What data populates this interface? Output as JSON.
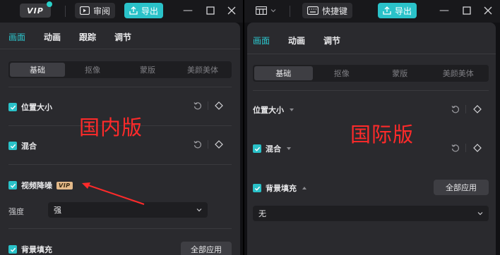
{
  "left": {
    "titlebar": {
      "vip_logo": "VIP",
      "review_label": "审阅",
      "export_label": "导出"
    },
    "tabs": [
      {
        "label": "画面",
        "active": true
      },
      {
        "label": "动画",
        "active": false
      },
      {
        "label": "跟踪",
        "active": false
      },
      {
        "label": "调节",
        "active": false
      }
    ],
    "subtabs": [
      {
        "label": "基础",
        "active": true
      },
      {
        "label": "抠像",
        "active": false
      },
      {
        "label": "蒙版",
        "active": false
      },
      {
        "label": "美颜美体",
        "active": false
      }
    ],
    "position_size": "位置大小",
    "blend": "混合",
    "video_denoise": "视频降噪",
    "vip_badge": "VIP",
    "strength_label": "强度",
    "strength_value": "强",
    "bg_fill": "背景填充",
    "apply_all": "全部应用",
    "annotation": "国内版"
  },
  "right": {
    "titlebar": {
      "shortcut_label": "快捷键",
      "export_label": "导出"
    },
    "tabs": [
      {
        "label": "画面",
        "active": true
      },
      {
        "label": "动画",
        "active": false
      },
      {
        "label": "调节",
        "active": false
      }
    ],
    "subtabs": [
      {
        "label": "基础",
        "active": true
      },
      {
        "label": "抠像",
        "active": false
      },
      {
        "label": "蒙版",
        "active": false
      },
      {
        "label": "美颜美体",
        "active": false
      }
    ],
    "position_size": "位置大小",
    "blend": "混合",
    "bg_fill": "背景填充",
    "apply_all": "全部应用",
    "fill_value": "无",
    "annotation": "国际版"
  },
  "colors": {
    "accent": "#2ac2c9",
    "annotation_red": "#ff2a2a",
    "vip_gold": "#e3b989"
  },
  "icons": [
    "review-icon",
    "export-icon",
    "layout-icon",
    "keyboard-icon",
    "minimize-icon",
    "maximize-icon",
    "close-icon",
    "reset-icon",
    "keyframe-icon",
    "chevron-down-icon",
    "check-icon"
  ]
}
